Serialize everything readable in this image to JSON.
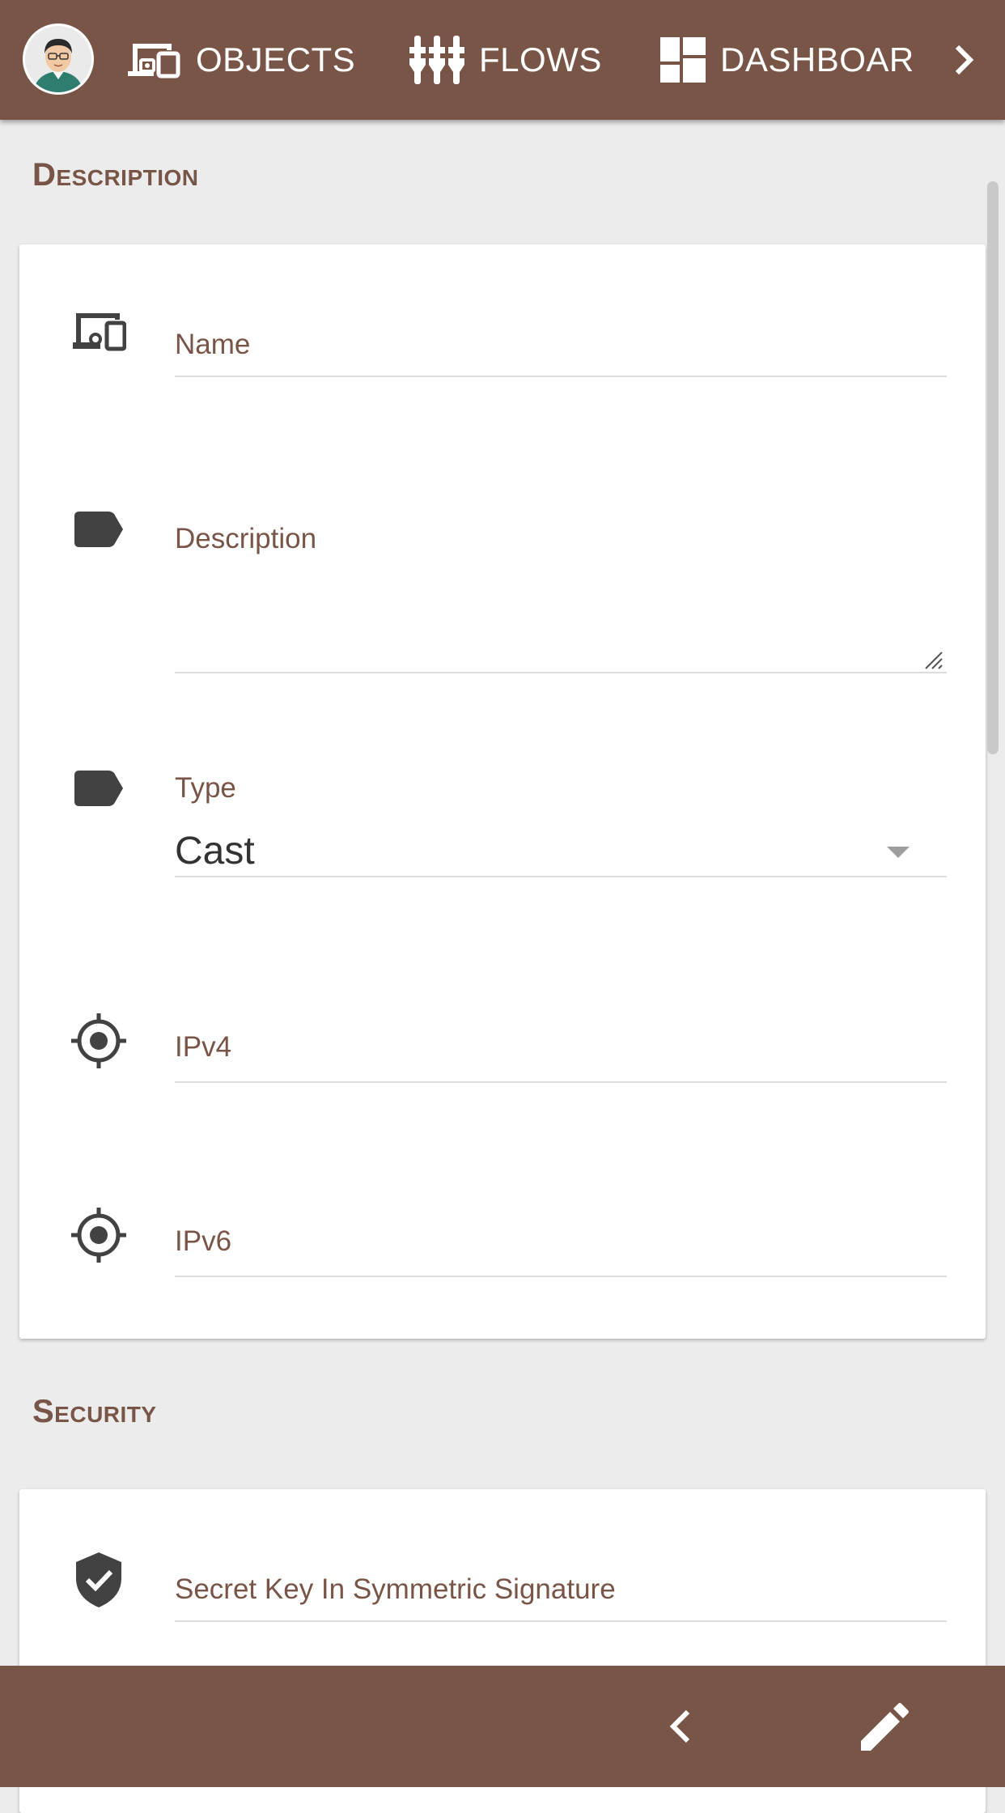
{
  "nav": {
    "items": [
      {
        "label": "OBJECTS",
        "icon": "devices-icon"
      },
      {
        "label": "FLOWS",
        "icon": "flows-icon"
      },
      {
        "label": "DASHBOAR",
        "icon": "dashboard-icon"
      }
    ],
    "next_icon": "chevron-right-icon"
  },
  "sections": {
    "description": {
      "title": "Description",
      "fields": {
        "name": {
          "label": "Name",
          "icon": "devices-icon"
        },
        "description": {
          "label": "Description",
          "icon": "label-icon"
        },
        "type": {
          "label": "Type",
          "value": "Cast",
          "icon": "label-icon"
        },
        "ipv4": {
          "label": "IPv4",
          "icon": "crosshair-icon"
        },
        "ipv6": {
          "label": "IPv6",
          "icon": "crosshair-icon"
        }
      }
    },
    "security": {
      "title": "Security",
      "fields": {
        "secret_key": {
          "label": "Secret Key In Symmetric Signature",
          "icon": "shield-check-icon"
        }
      }
    }
  },
  "bottom_bar": {
    "back_icon": "chevron-left-icon",
    "edit_icon": "pencil-icon"
  },
  "colors": {
    "primary": "#795548",
    "background": "#ececec",
    "card": "#ffffff",
    "icon": "#424242"
  }
}
